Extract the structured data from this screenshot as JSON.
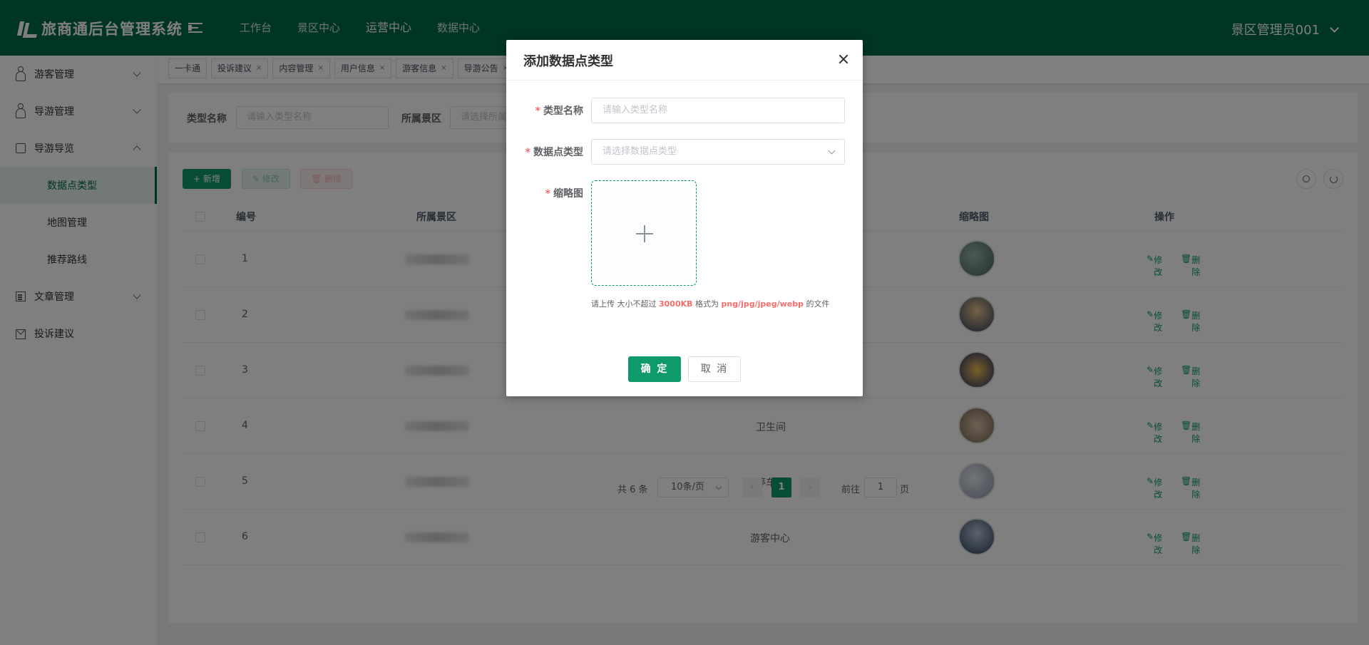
{
  "header": {
    "app_title": "旅商通后台管理系统",
    "nav": [
      "工作台",
      "景区中心",
      "运营中心",
      "数据中心"
    ],
    "active_nav_index": 2,
    "user": "景区管理员001",
    "brand_color": "#016847"
  },
  "sidebar": {
    "items": [
      {
        "label": "游客管理",
        "icon": "user-icon"
      },
      {
        "label": "导游管理",
        "icon": "guide-icon"
      },
      {
        "label": "导游导览",
        "icon": "map-icon",
        "children": [
          "数据点类型",
          "地图管理",
          "推荐路线"
        ]
      },
      {
        "label": "文章管理",
        "icon": "document-icon"
      },
      {
        "label": "投诉建议",
        "icon": "mail-icon"
      }
    ],
    "active_child": "数据点类型"
  },
  "tabs": [
    {
      "label": "一卡通",
      "closable": false
    },
    {
      "label": "投诉建议",
      "closable": true
    },
    {
      "label": "内容管理",
      "closable": true
    },
    {
      "label": "用户信息",
      "closable": true
    },
    {
      "label": "游客信息",
      "closable": true
    },
    {
      "label": "导游公告",
      "closable": true
    }
  ],
  "search": {
    "type_name_label": "类型名称",
    "type_name_placeholder": "请输入类型名称",
    "area_label": "所属景区",
    "area_placeholder": "请选择所属景区"
  },
  "toolbar": {
    "add": "+ 新增",
    "edit": "修改",
    "delete": "删除"
  },
  "table": {
    "columns": [
      "编号",
      "所属景区",
      "缩略图",
      "操作"
    ],
    "rows": [
      {
        "id": "1",
        "name": ""
      },
      {
        "id": "2",
        "name": ""
      },
      {
        "id": "3",
        "name": ""
      },
      {
        "id": "4",
        "name": "卫生间"
      },
      {
        "id": "5",
        "name": "停车场"
      },
      {
        "id": "6",
        "name": "游客中心"
      }
    ],
    "op_edit": "修改",
    "op_delete": "删除"
  },
  "pagination": {
    "total_text": "共 6 条",
    "page_size": "10条/页",
    "current_page": "1",
    "goto_label": "前往",
    "goto_value": "1",
    "page_unit": "页"
  },
  "modal": {
    "title": "添加数据点类型",
    "fields": [
      {
        "label": "类型名称",
        "placeholder": "请输入类型名称"
      },
      {
        "label": "数据点类型",
        "placeholder": "请选择数据点类型"
      },
      {
        "label": "缩略图"
      }
    ],
    "upload_tip_prefix": "请上传 大小不超过 ",
    "upload_tip_size": "3000KB",
    "upload_tip_mid": " 格式为 ",
    "upload_tip_formats": "png/jpg/jpeg/webp",
    "upload_tip_suffix": " 的文件",
    "ok": "确 定",
    "cancel": "取 消"
  }
}
